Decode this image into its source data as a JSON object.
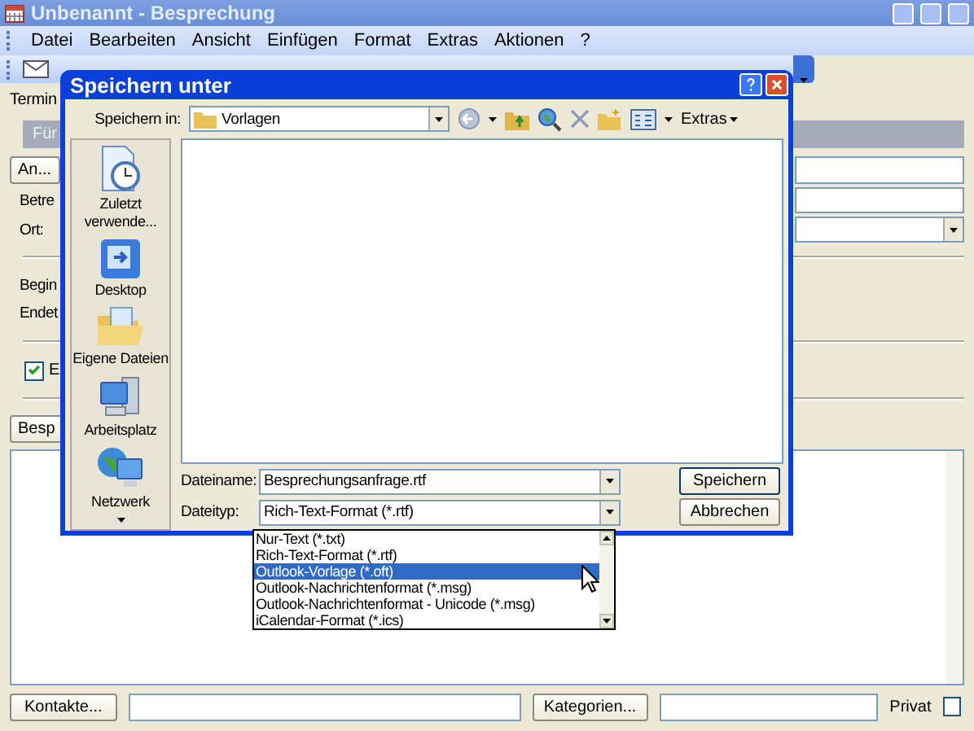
{
  "window": {
    "title": "Unbenannt - Besprechung"
  },
  "menu": [
    "Datei",
    "Bearbeiten",
    "Ansicht",
    "Einfügen",
    "Format",
    "Extras",
    "Aktionen",
    "?"
  ],
  "form": {
    "tab": "Termin",
    "info_bar": "Für",
    "to_button": "An...",
    "labels": [
      "Betre",
      "Ort:",
      "Begin",
      "Endet"
    ],
    "reminder": {
      "label": "E",
      "checked": true
    },
    "button_3": "Besp"
  },
  "footer": {
    "contacts_button": "Kontakte...",
    "categories_button": "Kategorien...",
    "private": {
      "label": "Privat",
      "checked": false
    }
  },
  "dialog": {
    "title": "Speichern unter",
    "save_in_label": "Speichern in:",
    "save_in_value": "Vorlagen",
    "extras_menu": "Extras",
    "places": [
      {
        "label": "Zuletzt verwende...",
        "kind": "recent"
      },
      {
        "label": "Desktop",
        "kind": "desktop"
      },
      {
        "label": "Eigene Dateien",
        "kind": "documents"
      },
      {
        "label": "Arbeitsplatz",
        "kind": "computer"
      },
      {
        "label": "Netzwerk",
        "kind": "network"
      }
    ],
    "filename_label": "Dateiname:",
    "filename": "Besprechungsanfrage.rtf",
    "filetype_label": "Dateityp:",
    "filetype": "Rich-Text-Format (*.rtf)",
    "filetype_options": [
      {
        "label": "Nur-Text (*.txt)",
        "selected": false
      },
      {
        "label": "Rich-Text-Format (*.rtf)",
        "selected": false
      },
      {
        "label": "Outlook-Vorlage (*.oft)",
        "selected": true
      },
      {
        "label": "Outlook-Nachrichtenformat (*.msg)",
        "selected": false
      },
      {
        "label": "Outlook-Nachrichtenformat - Unicode (*.msg)",
        "selected": false
      },
      {
        "label": "iCalendar-Format (*.ics)",
        "selected": false
      }
    ],
    "buttons": [
      "Speichern",
      "Abbrechen"
    ]
  }
}
